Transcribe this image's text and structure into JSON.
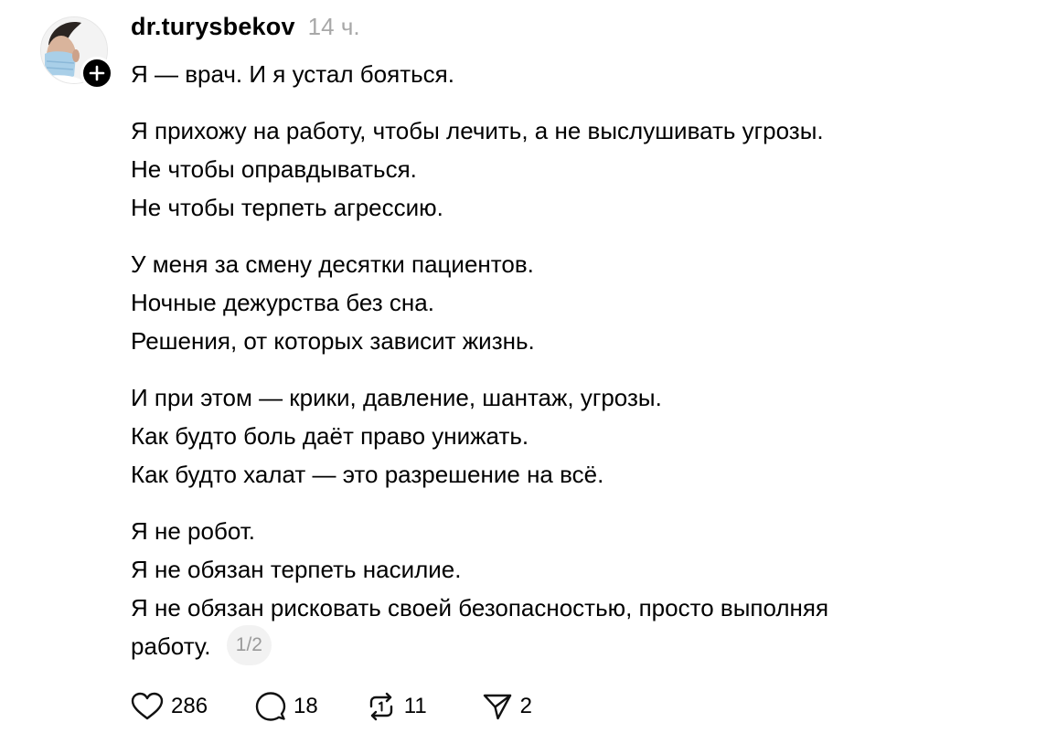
{
  "post": {
    "username": "dr.turysbekov",
    "time": "14 ч.",
    "paragraphs": [
      [
        "Я — врач. И я устал бояться."
      ],
      [
        "Я прихожу на работу, чтобы лечить, а не выслушивать угрозы.",
        "Не чтобы оправдываться.",
        "Не чтобы терпеть агрессию."
      ],
      [
        "У меня за смену десятки пациентов.",
        "Ночные дежурства без сна.",
        "Решения, от которых зависит жизнь."
      ],
      [
        "И при этом — крики, давление, шантаж, угрозы.",
        "Как будто боль даёт право унижать.",
        "Как будто халат — это разрешение на всё."
      ],
      [
        "Я не робот.",
        "Я не обязан терпеть насилие.",
        "Я не обязан рисковать своей безопасностью, просто выполняя",
        "работу."
      ]
    ],
    "page_indicator": "1/2"
  },
  "actions": {
    "likes": "286",
    "comments": "18",
    "reposts": "11",
    "shares": "2"
  },
  "icons": {
    "avatar": "profile-photo",
    "follow": "plus-icon",
    "like": "heart-icon",
    "comment": "comment-bubble-icon",
    "repost": "repost-icon",
    "share": "send-icon"
  }
}
